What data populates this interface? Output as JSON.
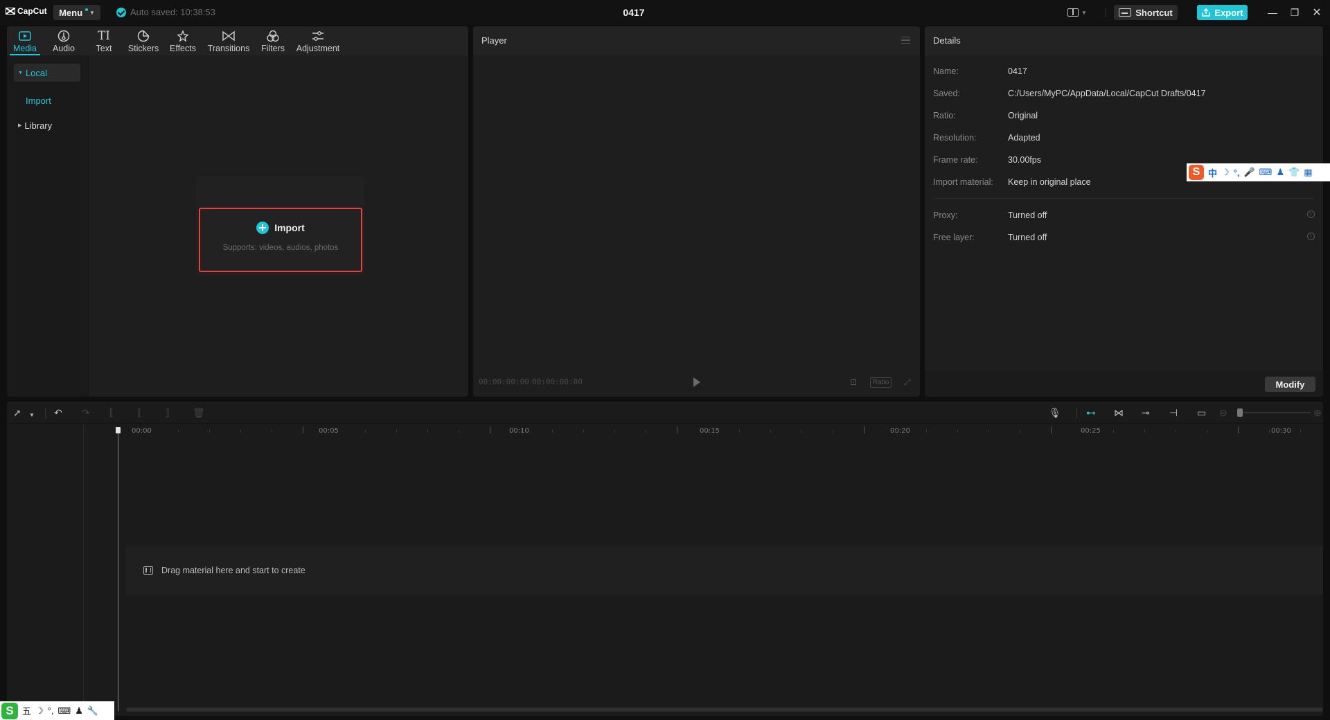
{
  "app": {
    "logo_text": "CapCut",
    "menu_label": "Menu",
    "autosave_text": "Auto saved: 10:38:53",
    "project_title": "0417",
    "shortcut_label": "Shortcut",
    "export_label": "Export",
    "accent_color": "#1fc7d6",
    "highlight_color": "#e8423c"
  },
  "toolbar": {
    "tabs": [
      {
        "label": "Media",
        "icon": "media-icon",
        "active": true
      },
      {
        "label": "Audio",
        "icon": "audio-icon"
      },
      {
        "label": "Text",
        "icon": "text-icon"
      },
      {
        "label": "Stickers",
        "icon": "sticker-icon"
      },
      {
        "label": "Effects",
        "icon": "effects-icon"
      },
      {
        "label": "Transitions",
        "icon": "transitions-icon"
      },
      {
        "label": "Filters",
        "icon": "filters-icon"
      },
      {
        "label": "Adjustment",
        "icon": "adjustment-icon"
      }
    ]
  },
  "sidebar": {
    "local": "Local",
    "import": "Import",
    "library": "Library"
  },
  "import_box": {
    "title": "Import",
    "subtitle": "Supports: videos, audios, photos"
  },
  "player": {
    "title": "Player",
    "time_current": "00:00:00:00",
    "time_total": "00:00:00:00",
    "ratio_label": "Ratio"
  },
  "details": {
    "title": "Details",
    "rows": [
      {
        "key": "Name:",
        "value": "0417"
      },
      {
        "key": "Saved:",
        "value": "C:/Users/MyPC/AppData/Local/CapCut Drafts/0417"
      },
      {
        "key": "Ratio:",
        "value": "Original"
      },
      {
        "key": "Resolution:",
        "value": "Adapted"
      },
      {
        "key": "Frame rate:",
        "value": "30.00fps"
      },
      {
        "key": "Import material:",
        "value": "Keep in original place"
      }
    ],
    "proxy_key": "Proxy:",
    "proxy_value": "Turned off",
    "freelayer_key": "Free layer:",
    "freelayer_value": "Turned off",
    "modify_label": "Modify"
  },
  "timeline": {
    "ruler_labels": [
      "00:00",
      "00:05",
      "00:10",
      "00:15",
      "00:20",
      "00:25",
      "00:30"
    ],
    "drag_hint": "Drag material here and start to create"
  },
  "ime_top": {
    "logo": "S",
    "glyphs": [
      "中",
      "☽",
      "°,",
      "🎤",
      "⌨",
      "♟",
      "👕",
      "▦"
    ]
  },
  "ime_bottom": {
    "logo": "S",
    "glyphs": [
      "五",
      "☽",
      "°,",
      "⌨",
      "♟",
      "🔧"
    ]
  }
}
